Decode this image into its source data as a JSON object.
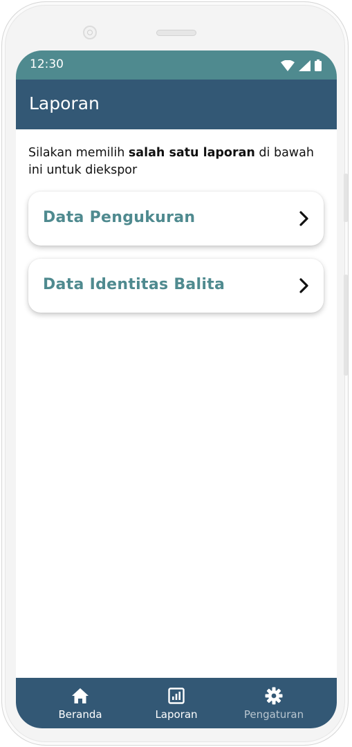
{
  "status_bar": {
    "time": "12:30",
    "icons": [
      "wifi-icon",
      "signal-icon",
      "battery-icon"
    ]
  },
  "app_bar": {
    "title": "Laporan"
  },
  "intro": {
    "prefix": "Silakan memilih ",
    "bold": "salah satu laporan",
    "suffix": " di bawah ini untuk diekspor"
  },
  "reports": [
    {
      "label": "Data Pengukuran",
      "icon": "chevron-right-icon"
    },
    {
      "label": "Data Identitas Balita",
      "icon": "chevron-right-icon"
    }
  ],
  "bottom_nav": [
    {
      "label": "Beranda",
      "icon": "home-icon"
    },
    {
      "label": "Laporan",
      "icon": "report-chart-icon"
    },
    {
      "label": "Pengaturan",
      "icon": "gear-icon"
    }
  ],
  "colors": {
    "status_bar": "#4f8a8f",
    "app_bar": "#335875",
    "accent_text": "#4f8a8f",
    "nav_inactive_text": "#b9c6d0"
  }
}
